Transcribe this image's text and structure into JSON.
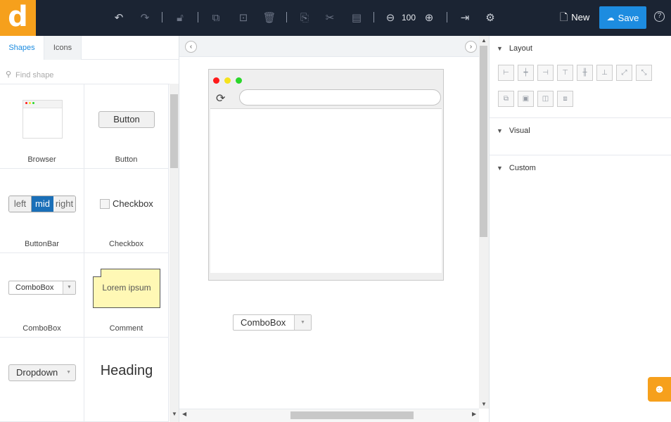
{
  "app": {
    "logo_letter": "d",
    "brand_color": "#f6a01c",
    "topbar_color": "#1b2433",
    "accent_color": "#1d8ce0"
  },
  "toolbar": {
    "icons": {
      "undo": "undo-icon",
      "redo": "redo-icon",
      "lock": "lock-icon",
      "group": "group-icon",
      "ungroup": "ungroup-icon",
      "delete": "trash-icon",
      "duplicate": "duplicate-icon",
      "cut": "scissors-icon",
      "paste": "paste-icon",
      "zoom_out": "zoom-out-icon",
      "zoom_in": "zoom-in-icon",
      "export": "export-icon",
      "settings": "gear-icon",
      "help": "help-icon"
    },
    "zoom_level": "100",
    "new_label": "New",
    "save_label": "Save",
    "help_glyph": "?"
  },
  "left_panel": {
    "tabs": [
      {
        "label": "Shapes",
        "active": true
      },
      {
        "label": "Icons",
        "active": false
      }
    ],
    "search": {
      "placeholder": "Find shape",
      "value": ""
    },
    "shapes": [
      {
        "label": "Browser"
      },
      {
        "label": "Button",
        "preview": "Button"
      },
      {
        "label": "ButtonBar",
        "preview": [
          "left",
          "mid",
          "right"
        ],
        "selected": "mid"
      },
      {
        "label": "Checkbox",
        "preview": "Checkbox"
      },
      {
        "label": "ComboBox",
        "preview": "ComboBox"
      },
      {
        "label": "Comment",
        "preview": "Lorem ipsum"
      },
      {
        "label": "",
        "preview": "Dropdown"
      },
      {
        "label": "",
        "preview": "Heading"
      }
    ]
  },
  "canvas": {
    "mock_browser": {
      "dots": [
        "#ff1a1a",
        "#f5e21d",
        "#2ad62a"
      ],
      "url": ""
    },
    "combobox": {
      "label": "ComboBox"
    }
  },
  "right_panel": {
    "sections": [
      {
        "label": "Layout",
        "expanded": true
      },
      {
        "label": "Visual",
        "expanded": false
      },
      {
        "label": "Custom",
        "expanded": false
      }
    ]
  }
}
